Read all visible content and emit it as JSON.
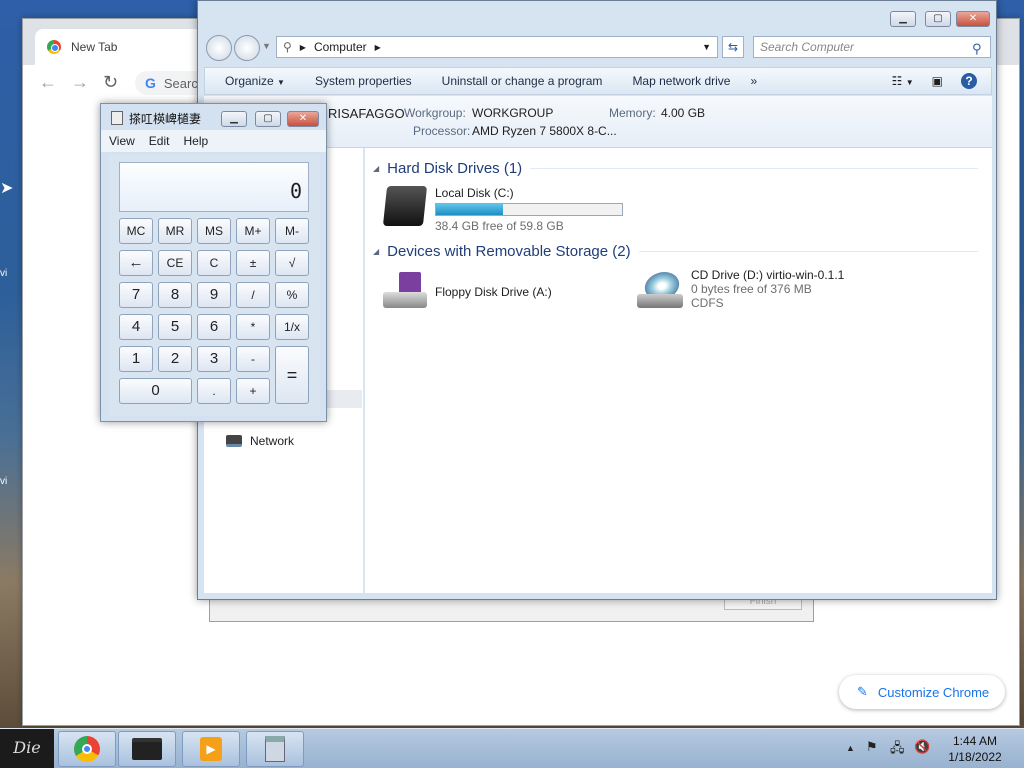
{
  "desktop": {
    "edge_glyph_1": "vi",
    "edge_glyph_2": "vi"
  },
  "chrome": {
    "tab_label": "New Tab",
    "omnibox_text": "Searc",
    "customize_label": "Customize Chrome"
  },
  "dialog": {
    "finish_label": "Finish"
  },
  "explorer": {
    "address_location": "Computer",
    "search_placeholder": "Search Computer",
    "toolbar": {
      "organize": "Organize",
      "system_properties": "System properties",
      "uninstall": "Uninstall or change a program",
      "map_drive": "Map network drive",
      "more": "»"
    },
    "info": {
      "computer_name": "RISAFAGGO",
      "workgroup_label": "Workgroup:",
      "workgroup_value": "WORKGROUP",
      "memory_label": "Memory:",
      "memory_value": "4.00 GB",
      "processor_label": "Processor:",
      "processor_value": "AMD Ryzen 7 5800X 8-C..."
    },
    "nav": {
      "network": "Network"
    },
    "groups": {
      "hdd_title": "Hard Disk Drives (1)",
      "removable_title": "Devices with Removable Storage (2)"
    },
    "drives": {
      "c_name": "Local Disk (C:)",
      "c_free": "38.4 GB free of 59.8 GB",
      "c_used_fraction": 0.358,
      "a_name": "Floppy Disk Drive (A:)",
      "d_name": "CD Drive (D:) virtio-win-0.1.1",
      "d_free": "0 bytes free of 376 MB",
      "d_fs": "CDFS"
    }
  },
  "calculator": {
    "title": "搽叿楧崥檤妻",
    "menu": {
      "view": "View",
      "edit": "Edit",
      "help": "Help"
    },
    "display": "0",
    "keys": {
      "mc": "MC",
      "mr": "MR",
      "ms": "MS",
      "mplus": "M+",
      "mminus": "M-",
      "back": "←",
      "ce": "CE",
      "c": "C",
      "plusminus": "±",
      "sqrt": "√",
      "k7": "7",
      "k8": "8",
      "k9": "9",
      "div": "/",
      "pct": "%",
      "k4": "4",
      "k5": "5",
      "k6": "6",
      "mul": "*",
      "recip": "1/x",
      "k1": "1",
      "k2": "2",
      "k3": "3",
      "sub": "-",
      "eq": "=",
      "k0": "0",
      "dot": ".",
      "add": "+"
    }
  },
  "taskbar": {
    "start_label": "Die",
    "time": "1:44 AM",
    "date": "1/18/2022"
  },
  "colors": {
    "accent": "#1a73e8",
    "disk_bar": "#1c8fc4"
  }
}
